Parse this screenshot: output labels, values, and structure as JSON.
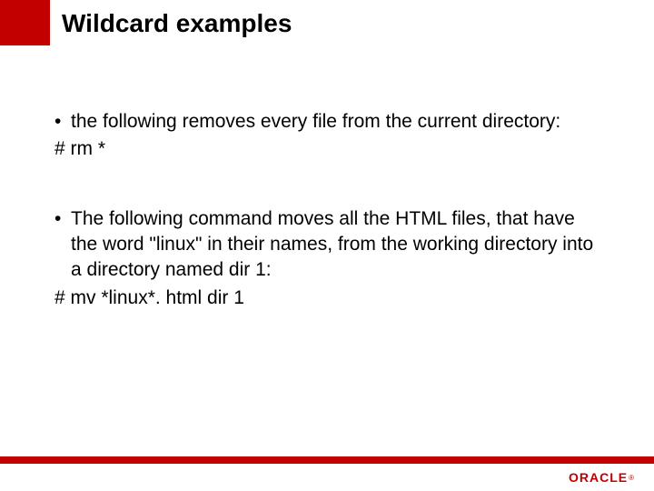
{
  "title": "Wildcard examples",
  "bullets": [
    {
      "text": "the following removes every file from the current directory:",
      "command": "#  rm   *"
    },
    {
      "text": "The following command moves all the HTML files, that have the word \"linux\" in their names, from the working directory into a directory named dir 1:",
      "command": "#    mv    *linux*. html       dir 1"
    }
  ],
  "brand": "ORACLE"
}
